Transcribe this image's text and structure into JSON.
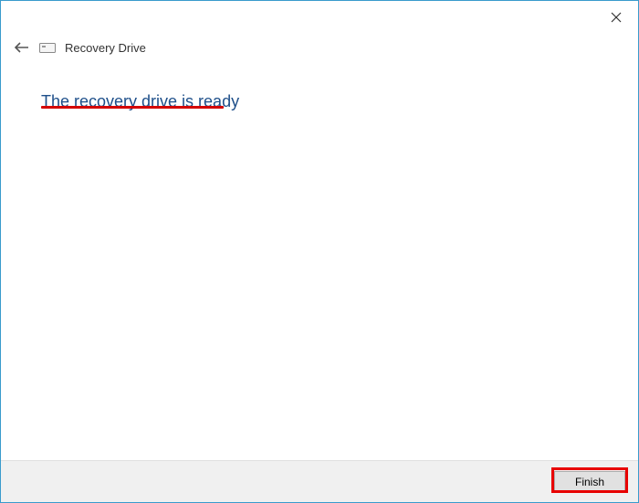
{
  "header": {
    "title": "Recovery Drive"
  },
  "content": {
    "heading": "The recovery drive is ready"
  },
  "footer": {
    "finish_label": "Finish"
  }
}
